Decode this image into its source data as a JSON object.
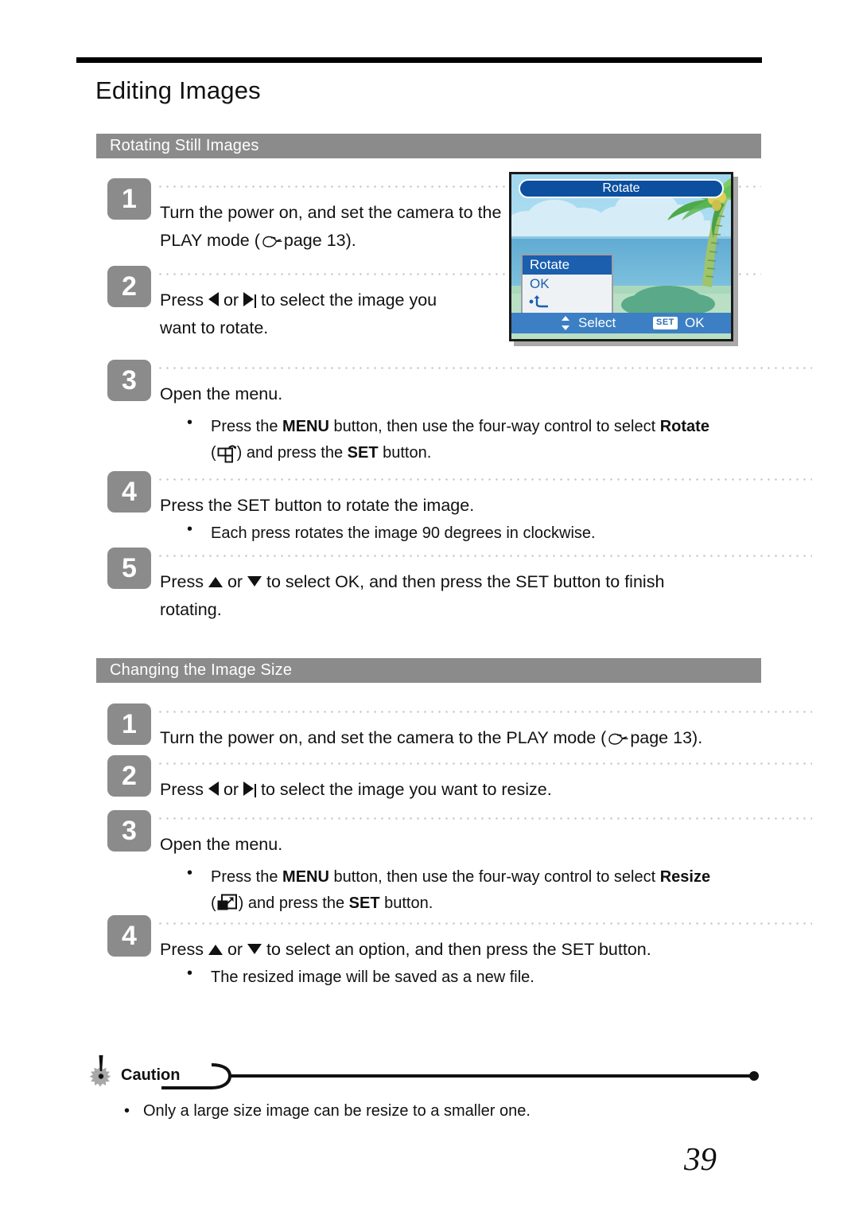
{
  "document": {
    "page_title": "Editing Images",
    "page_number": "39"
  },
  "sections": [
    {
      "heading": "Rotating Still Images",
      "steps": [
        {
          "number": "1",
          "text_before": "Turn the power on, and set the camera to the PLAY mode (",
          "icon": "pointing-hand-icon",
          "text_after": "page 13)."
        },
        {
          "number": "2",
          "text_lead": "Press",
          "icon_left": "arrow-left-icon",
          "text_or": "or",
          "icon_right": "arrow-right-icon",
          "text_tail": "to select the image you",
          "text_line2": "want to rotate."
        },
        {
          "number": "3",
          "text": "Open the menu.",
          "bullet_before": "Press the ",
          "bullet_menu": "MENU",
          "bullet_mid": " button, then use the four-way control to select ",
          "bullet_target": "Rotate",
          "bullet_icon": "rotate-icon",
          "bullet_after": ") and press the ",
          "bullet_set": "SET",
          "bullet_end": " button."
        },
        {
          "number": "4",
          "text": "Press the SET button to rotate the image.",
          "bullet": "Each press rotates the image 90 degrees in clockwise."
        },
        {
          "number": "5",
          "text_lead": "Press",
          "icon_up": "arrow-up-icon",
          "text_or": "or",
          "icon_down": "arrow-down-icon",
          "text_tail": "to select OK, and then press the SET button to finish",
          "text_line2": "rotating."
        }
      ]
    },
    {
      "heading": "Changing the Image Size",
      "steps": [
        {
          "number": "1",
          "text_before": "Turn the power on, and set the camera to the PLAY mode (",
          "icon": "pointing-hand-icon",
          "text_after": "page 13)."
        },
        {
          "number": "2",
          "text_lead": "Press",
          "icon_left": "arrow-left-icon",
          "text_or": "or",
          "icon_right": "arrow-right-icon",
          "text_tail": "to select the image you want to resize."
        },
        {
          "number": "3",
          "text": "Open the menu.",
          "bullet_before": "Press the ",
          "bullet_menu": "MENU",
          "bullet_mid": " button, then use the four-way control to select ",
          "bullet_target": "Resize",
          "bullet_icon": "resize-icon",
          "bullet_after": ") and press the ",
          "bullet_set": "SET",
          "bullet_end": " button."
        },
        {
          "number": "4",
          "text_lead": "Press",
          "icon_up": "arrow-up-icon",
          "text_or": "or",
          "icon_down": "arrow-down-icon",
          "text_tail": "to select an option, and then press the SET button.",
          "bullet": "The resized image will be saved as a new file."
        }
      ]
    }
  ],
  "caution": {
    "label": "Caution",
    "icon": "warning-burst-icon",
    "items": [
      "Only a large size image can be resize to a smaller one."
    ]
  },
  "lcd_screen": {
    "title": "Rotate",
    "menu_items": [
      {
        "label": "Rotate",
        "selected": true
      },
      {
        "label": "OK",
        "selected": false
      },
      {
        "label": "back-arrow-icon",
        "selected": false
      }
    ],
    "status_bar": {
      "updown_icon": "up-down-arrow-icon",
      "select_label": "Select",
      "set_badge": "SET",
      "ok_label": "OK"
    },
    "scene": "tropical-beach-with-palm-tree"
  },
  "colors": {
    "section_bar": "#8b8b8b",
    "step_badge": "#8b8b8b",
    "lcd_title_bg": "#0b4f9e",
    "lcd_status_bg": "#3c7fc4",
    "lcd_menu_selected": "#1b5fae",
    "rule": "#000000"
  }
}
